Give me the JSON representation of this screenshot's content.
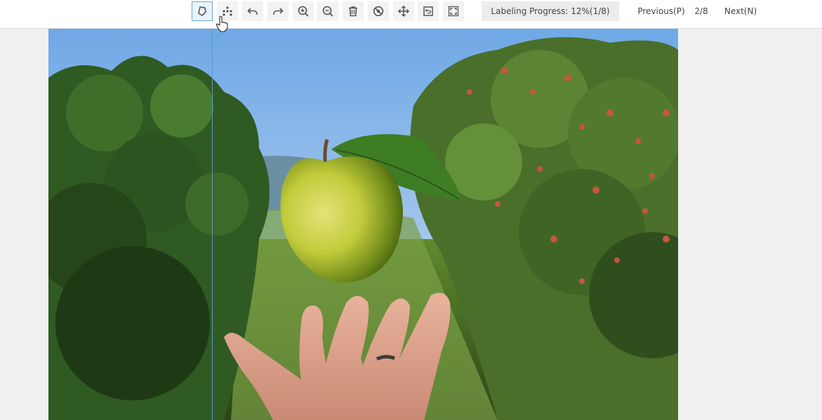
{
  "toolbar": {
    "tools": [
      {
        "name": "polygon-tool",
        "active": true
      },
      {
        "name": "keypoint-tool",
        "active": false
      },
      {
        "name": "undo",
        "active": false
      },
      {
        "name": "redo",
        "active": false
      },
      {
        "name": "zoom-in",
        "active": false
      },
      {
        "name": "zoom-out",
        "active": false
      },
      {
        "name": "delete",
        "active": false
      },
      {
        "name": "hide-annotations",
        "active": false
      },
      {
        "name": "move",
        "active": false
      },
      {
        "name": "reset-view",
        "active": false
      },
      {
        "name": "fullscreen",
        "active": false
      }
    ],
    "labeling_progress_text": "Labeling Progress: 12%(1/8)",
    "progress_fraction": 0.125,
    "previous_label": "Previous(P)",
    "page_indicator": "2/8",
    "next_label": "Next(N)"
  },
  "canvas": {
    "image_description": "photo-of-green-apple-above-hand-in-orchard"
  },
  "colors": {
    "active_tool_border": "#6ea6d6",
    "active_tool_bg": "#eaf3fb",
    "crosshair": "#5a98c9"
  }
}
